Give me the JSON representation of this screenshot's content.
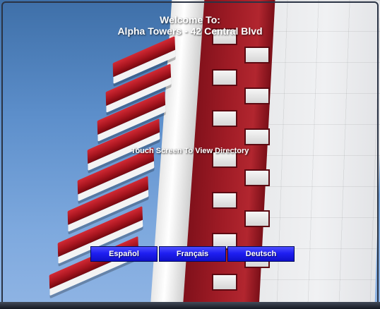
{
  "header": {
    "welcome_line_1": "Welcome To:",
    "welcome_line_2": "Alpha Towers - 42 Central Blvd"
  },
  "main": {
    "touch_prompt": "Touch Screen To View Directory"
  },
  "languages": [
    {
      "label": "Español"
    },
    {
      "label": "Français"
    },
    {
      "label": "Deutsch"
    }
  ],
  "colors": {
    "sky": "#5d8fcb",
    "facade_red": "#9e1b25",
    "button_blue": "#1f1ff2",
    "text_white": "#ffffff"
  }
}
